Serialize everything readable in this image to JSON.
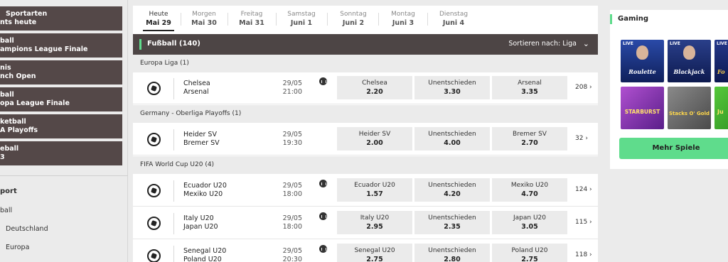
{
  "sidebar": {
    "quick_links": [
      {
        "line1": "Sportarten",
        "line2": "nts heute"
      },
      {
        "line1": "ball",
        "line2": "ampions League Finale"
      },
      {
        "line1": "nis",
        "line2": "nch Open"
      },
      {
        "line1": "ball",
        "line2": "opa League Finale"
      },
      {
        "line1": "ketball",
        "line2": "A Playoffs"
      },
      {
        "line1": "eball",
        "line2": "3"
      }
    ],
    "heading": "port",
    "links": [
      "ball",
      "Deutschland",
      "Europa"
    ]
  },
  "days": [
    {
      "name": "Heute",
      "date": "Mai 29"
    },
    {
      "name": "Morgen",
      "date": "Mai 30"
    },
    {
      "name": "Freitag",
      "date": "Mai 31"
    },
    {
      "name": "Samstag",
      "date": "Juni 1"
    },
    {
      "name": "Sonntag",
      "date": "Juni 2"
    },
    {
      "name": "Montag",
      "date": "Juni 3"
    },
    {
      "name": "Dienstag",
      "date": "Juni 4"
    }
  ],
  "sport_bar": {
    "title": "Fußball (140)",
    "sort_label": "Sortieren nach:",
    "sort_value": "Liga",
    "chevron": "⌄"
  },
  "leagues": [
    "Europa Liga (1)",
    "Germany - Oberliga Playoffs (1)",
    "FIFA World Cup U20 (4)"
  ],
  "events": [
    {
      "home": "Chelsea",
      "away": "Arsenal",
      "date": "29/05",
      "time": "21:00",
      "odds": [
        {
          "label": "Chelsea",
          "value": "2.20"
        },
        {
          "label": "Unentschieden",
          "value": "3.30"
        },
        {
          "label": "Arsenal",
          "value": "3.35"
        }
      ],
      "more": "208 ›"
    },
    {
      "home": "Heider SV",
      "away": "Bremer SV",
      "date": "29/05",
      "time": "19:30",
      "odds": [
        {
          "label": "Heider SV",
          "value": "2.00"
        },
        {
          "label": "Unentschieden",
          "value": "4.00"
        },
        {
          "label": "Bremer SV",
          "value": "2.70"
        }
      ],
      "more": "32 ›"
    },
    {
      "home": "Ecuador U20",
      "away": "Mexiko U20",
      "date": "29/05",
      "time": "18:00",
      "odds": [
        {
          "label": "Ecuador U20",
          "value": "1.57"
        },
        {
          "label": "Unentschieden",
          "value": "4.20"
        },
        {
          "label": "Mexiko U20",
          "value": "4.70"
        }
      ],
      "more": "124 ›"
    },
    {
      "home": "Italy U20",
      "away": "Japan U20",
      "date": "29/05",
      "time": "18:00",
      "odds": [
        {
          "label": "Italy U20",
          "value": "2.95"
        },
        {
          "label": "Unentschieden",
          "value": "2.35"
        },
        {
          "label": "Japan U20",
          "value": "3.05"
        }
      ],
      "more": "115 ›"
    },
    {
      "home": "Senegal U20",
      "away": "Poland U20",
      "date": "29/05",
      "time": "20:30",
      "odds": [
        {
          "label": "Senegal U20",
          "value": "2.75"
        },
        {
          "label": "Unentschieden",
          "value": "2.80"
        },
        {
          "label": "Poland U20",
          "value": "2.75"
        }
      ],
      "more": "118 ›"
    }
  ],
  "gaming": {
    "title": "Gaming",
    "tiles": [
      {
        "live": "LIVE",
        "name": "Roulette",
        "color": "#1e3a8c"
      },
      {
        "live": "LIVE",
        "name": "Blackjack",
        "color": "#1e2f6b"
      },
      {
        "live": "LIVE",
        "name": "Fo",
        "color": "#1a2a66"
      },
      {
        "live": "",
        "name": "STARBURST",
        "color": "#8b3fb8"
      },
      {
        "live": "",
        "name": "Stacks O' Gold",
        "color": "#6b6b6b"
      },
      {
        "live": "",
        "name": "Ju",
        "color": "#3fae2a"
      }
    ],
    "more_button": "Mehr Spiele"
  }
}
